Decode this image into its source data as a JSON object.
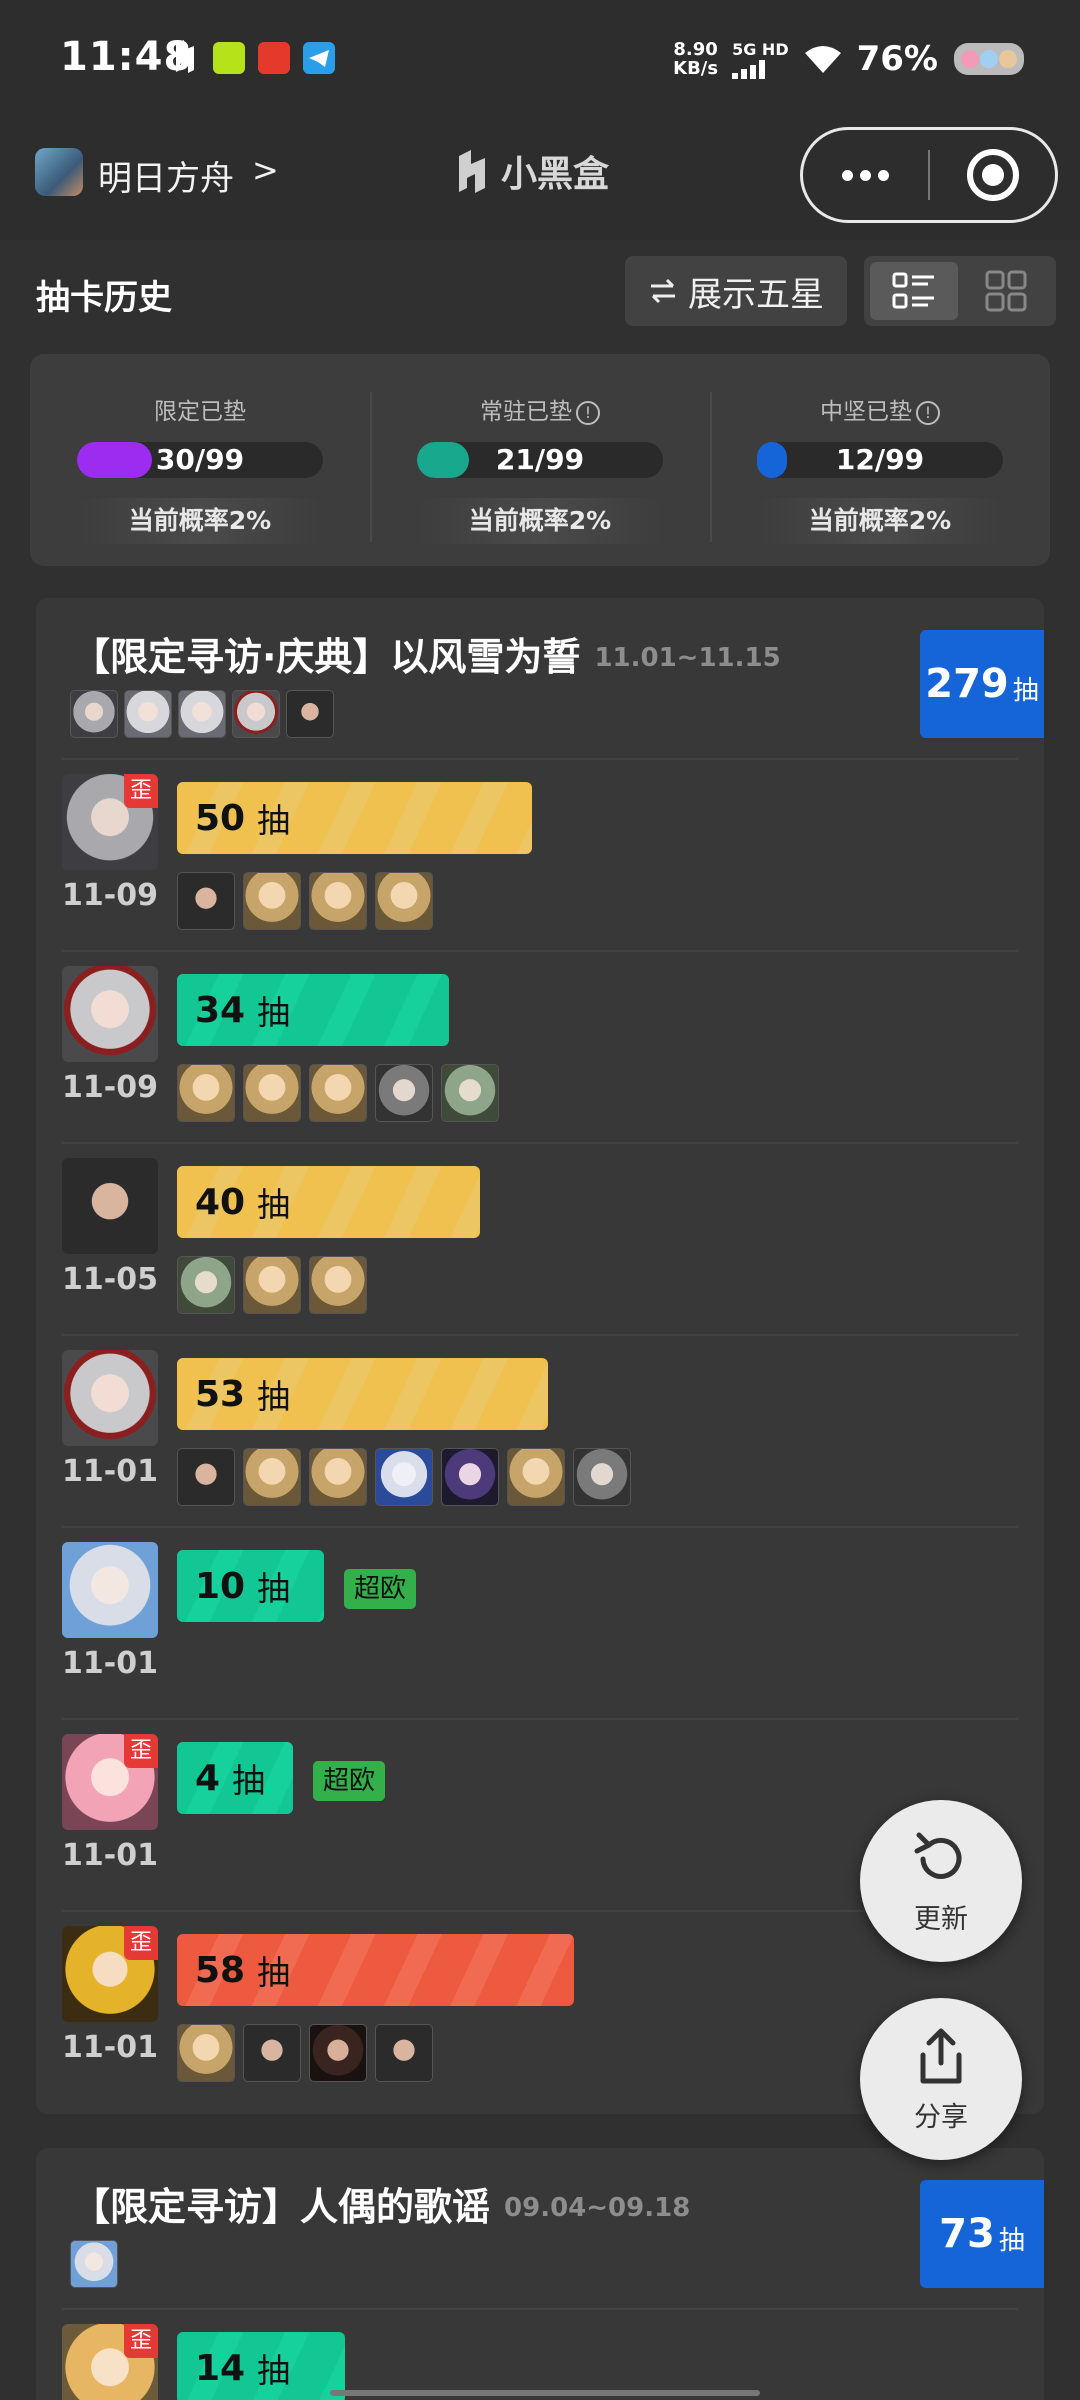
{
  "status_bar": {
    "time": "11:48",
    "net_speed": "8.90",
    "net_unit": "KB/s",
    "network": "5G HD",
    "battery": "76%"
  },
  "nav": {
    "game_name": "明日方舟",
    "chevron": ">",
    "app_title": "小黑盒"
  },
  "header": {
    "title": "抽卡历史",
    "toggle_label": "展示五星",
    "toggle_icon": "swap-icon",
    "view_modes": [
      "list",
      "grid"
    ],
    "active_view": "list"
  },
  "pity": [
    {
      "label": "限定已垫",
      "value": "30/99",
      "count": 30,
      "max": 99,
      "color": "#9b2cf0",
      "rate": "当前概率2%",
      "has_info": false
    },
    {
      "label": "常驻已垫",
      "value": "21/99",
      "count": 21,
      "max": 99,
      "color": "#17a88d",
      "rate": "当前概率2%",
      "has_info": true
    },
    {
      "label": "中坚已垫",
      "value": "12/99",
      "count": 12,
      "max": 99,
      "color": "#1565d8",
      "rate": "当前概率2%",
      "has_info": true
    }
  ],
  "banners": [
    {
      "title": "【限定寻访·庆典】以风雪为誓",
      "dates": "11.01~11.15",
      "total": "279",
      "total_unit": "抽",
      "featured": [
        "p-silver",
        "p-white",
        "p-white",
        "p-redw",
        "p-dark"
      ],
      "records": [
        {
          "date": "11-09",
          "pulls": "50",
          "unit": "抽",
          "pulls_n": 50,
          "color": "yellow",
          "off_banner": true,
          "off_label": "歪",
          "portrait": "p-silver",
          "history": [
            "p-dark",
            "p-blond",
            "p-blond",
            "p-blond"
          ]
        },
        {
          "date": "11-09",
          "pulls": "34",
          "unit": "抽",
          "pulls_n": 34,
          "color": "green",
          "off_banner": false,
          "portrait": "p-redw",
          "history": [
            "p-blond",
            "p-blond",
            "p-blond",
            "p-grey",
            "p-green"
          ]
        },
        {
          "date": "11-05",
          "pulls": "40",
          "unit": "抽",
          "pulls_n": 40,
          "color": "yellow",
          "off_banner": false,
          "portrait": "p-dark",
          "history": [
            "p-green",
            "p-blond",
            "p-blond"
          ]
        },
        {
          "date": "11-01",
          "pulls": "53",
          "unit": "抽",
          "pulls_n": 53,
          "color": "yellow",
          "off_banner": false,
          "portrait": "p-redw",
          "history": [
            "p-dark",
            "p-blond",
            "p-blond",
            "p-bluew",
            "p-purple",
            "p-blond",
            "p-grey"
          ]
        },
        {
          "date": "11-01",
          "pulls": "10",
          "unit": "抽",
          "pulls_n": 10,
          "color": "green",
          "off_banner": false,
          "lucky": "超欧",
          "portrait": "p-sky",
          "history": []
        },
        {
          "date": "11-01",
          "pulls": "4",
          "unit": "抽",
          "pulls_n": 4,
          "color": "green",
          "off_banner": true,
          "off_label": "歪",
          "lucky": "超欧",
          "portrait": "p-pink",
          "history": []
        },
        {
          "date": "11-01",
          "pulls": "58",
          "unit": "抽",
          "pulls_n": 58,
          "color": "red",
          "off_banner": true,
          "off_label": "歪",
          "portrait": "p-gold",
          "history": [
            "p-blond",
            "p-dark",
            "p-brown",
            "p-dark"
          ]
        }
      ]
    },
    {
      "title": "【限定寻访】人偶的歌谣",
      "dates": "09.04~09.18",
      "total": "73",
      "total_unit": "抽",
      "featured": [
        "p-sky"
      ],
      "records": [
        {
          "date": "",
          "pulls": "14",
          "unit": "抽",
          "pulls_n": 14,
          "color": "green",
          "off_banner": true,
          "off_label": "歪",
          "portrait": "p-fox",
          "history": []
        }
      ]
    }
  ],
  "fabs": [
    {
      "label": "更新",
      "icon": "refresh-icon"
    },
    {
      "label": "分享",
      "icon": "share-icon"
    }
  ]
}
